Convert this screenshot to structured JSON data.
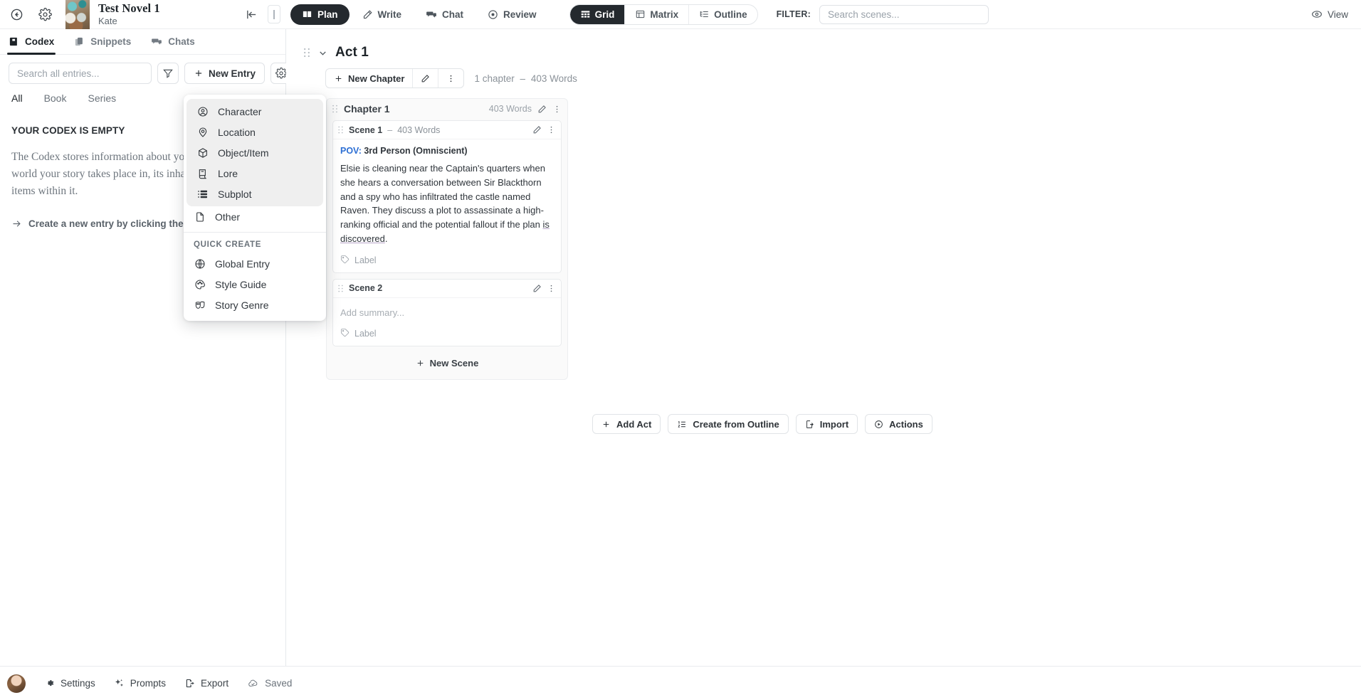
{
  "topbar": {
    "back_icon": "arrow-left-circle-icon",
    "settings_icon": "gear-icon",
    "book_title": "Test Novel 1",
    "author": "Kate",
    "collapse_icon": "collapse-left-icon",
    "divider_icon": "panel-divider-icon",
    "modes": [
      {
        "label": "Plan",
        "icon": "book-open-icon",
        "active": true
      },
      {
        "label": "Write",
        "icon": "pencil-icon",
        "active": false
      },
      {
        "label": "Chat",
        "icon": "chat-bubbles-icon",
        "active": false
      },
      {
        "label": "Review",
        "icon": "target-icon",
        "active": false
      }
    ],
    "views": [
      {
        "label": "Grid",
        "icon": "grid-icon",
        "active": true
      },
      {
        "label": "Matrix",
        "icon": "matrix-icon",
        "active": false
      },
      {
        "label": "Outline",
        "icon": "outline-icon",
        "active": false
      }
    ],
    "filter_label": "FILTER:",
    "filter_placeholder": "Search scenes...",
    "filter_value": "",
    "view_button": {
      "label": "View",
      "icon": "eye-icon"
    }
  },
  "sidebar": {
    "tabs": [
      {
        "label": "Codex",
        "icon": "book-icon",
        "active": true
      },
      {
        "label": "Snippets",
        "icon": "snippet-icon",
        "active": false
      },
      {
        "label": "Chats",
        "icon": "chats-icon",
        "active": false
      }
    ],
    "search_placeholder": "Search all entries...",
    "search_value": "",
    "filter_icon": "funnel-icon",
    "new_entry_label": "New Entry",
    "new_entry_icon": "plus-icon",
    "settings_icon": "gear-icon",
    "scopes": [
      {
        "label": "All",
        "active": true
      },
      {
        "label": "Book",
        "active": false
      },
      {
        "label": "Series",
        "active": false
      }
    ],
    "empty_title": "YOUR CODEX IS EMPTY",
    "empty_body": "The Codex stores information about your story — the world your story takes place in, its inhabitants, and the items within it.",
    "empty_cta_icon": "arrow-right-icon",
    "empty_cta": "Create a new entry by clicking the button above."
  },
  "menu": {
    "items": [
      {
        "label": "Character",
        "icon": "user-circle-icon",
        "highlighted": true
      },
      {
        "label": "Location",
        "icon": "map-pin-icon",
        "highlighted": true
      },
      {
        "label": "Object/Item",
        "icon": "cube-icon",
        "highlighted": true
      },
      {
        "label": "Lore",
        "icon": "scroll-icon",
        "highlighted": true
      },
      {
        "label": "Subplot",
        "icon": "subplot-icon",
        "highlighted": true
      },
      {
        "label": "Other",
        "icon": "document-icon",
        "highlighted": false
      }
    ],
    "quick_create_title": "QUICK CREATE",
    "quick_items": [
      {
        "label": "Global Entry",
        "icon": "globe-icon"
      },
      {
        "label": "Style Guide",
        "icon": "palette-icon"
      },
      {
        "label": "Story Genre",
        "icon": "masks-icon"
      }
    ]
  },
  "board": {
    "act": {
      "title": "Act 1",
      "grip_icon": "drag-handle-icon",
      "collapse_icon": "chevron-down-icon",
      "new_chapter_label": "New Chapter",
      "new_chapter_icon": "plus-icon",
      "edit_icon": "pencil-icon",
      "more_icon": "kebab-menu-icon",
      "meta_chapters": "1 chapter",
      "meta_dash": "–",
      "meta_words": "403 Words"
    },
    "chapter": {
      "title": "Chapter 1",
      "words": "403 Words",
      "grip_icon": "drag-handle-icon",
      "edit_icon": "pencil-icon",
      "more_icon": "kebab-menu-icon"
    },
    "scenes": [
      {
        "name": "Scene 1",
        "dash": "–",
        "words": "403 Words",
        "pov_key": "POV:",
        "pov_value": "3rd Person (Omniscient)",
        "summary_main": "Elsie is cleaning near the Captain's quarters when she hears a conversation between Sir Blackthorn and a spy who has infiltrated the castle named Raven. They discuss a plot to assassinate a high-ranking official and the potential fallout if the plan ",
        "summary_underlined": "is discovered",
        "summary_tail": ".",
        "label": "Label",
        "label_icon": "tag-icon"
      },
      {
        "name": "Scene 2",
        "dash": "",
        "words": "",
        "summary_placeholder": "Add summary...",
        "label": "Label",
        "label_icon": "tag-icon"
      }
    ],
    "new_scene_label": "New Scene",
    "new_scene_icon": "plus-icon",
    "actions": [
      {
        "label": "Add Act",
        "icon": "plus-icon"
      },
      {
        "label": "Create from Outline",
        "icon": "numbered-list-icon"
      },
      {
        "label": "Import",
        "icon": "import-icon"
      },
      {
        "label": "Actions",
        "icon": "play-circle-icon"
      }
    ]
  },
  "statusbar": {
    "avatar_icon": "avatar",
    "items": [
      {
        "label": "Settings",
        "icon": "gear-icon"
      },
      {
        "label": "Prompts",
        "icon": "sparkles-icon"
      },
      {
        "label": "Export",
        "icon": "export-icon"
      },
      {
        "label": "Saved",
        "icon": "cloud-check-icon"
      }
    ]
  },
  "colors": {
    "accent_dark": "#24292e",
    "pov_blue": "#2d6fd4",
    "muted_text": "#8b9299",
    "border": "#e1e4e7"
  }
}
